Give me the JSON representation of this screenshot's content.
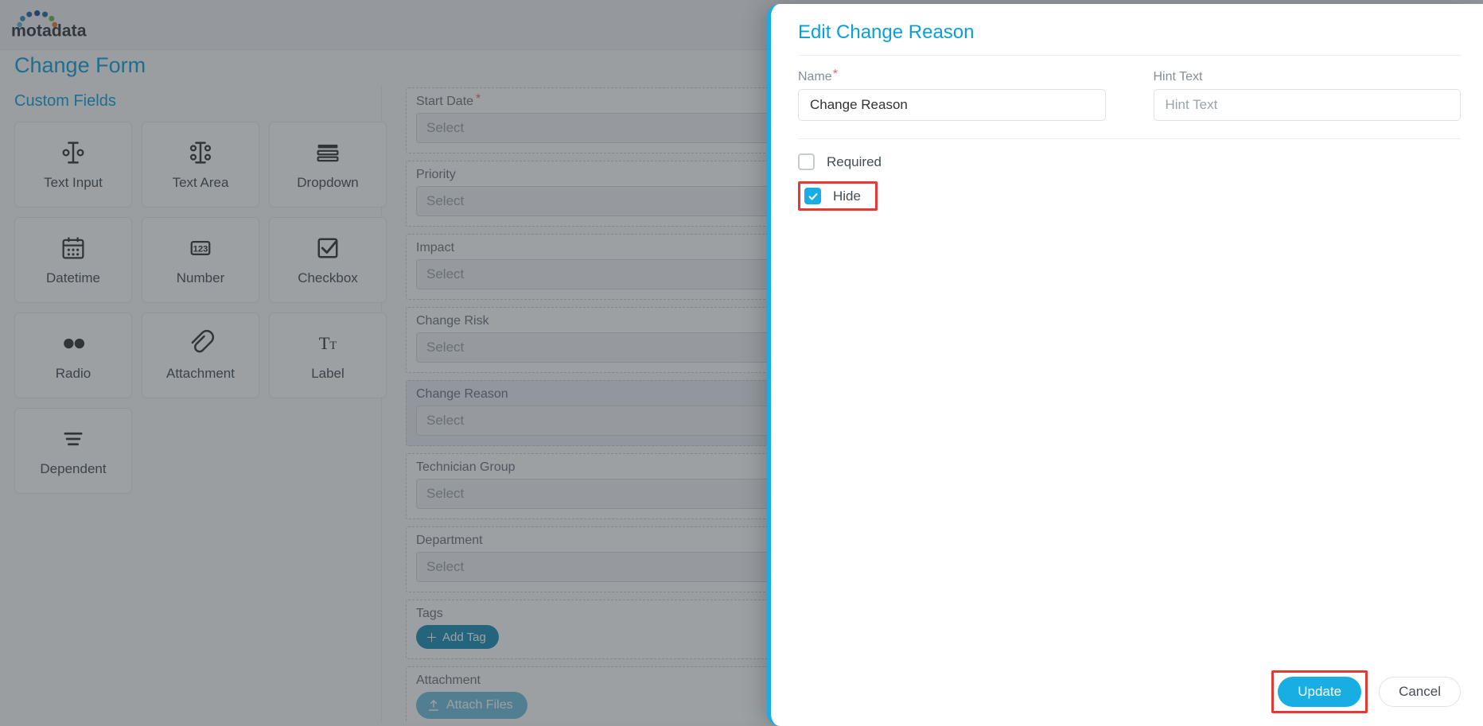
{
  "logo_text": "motadata",
  "page_title": "Change Form",
  "custom_fields_title": "Custom Fields",
  "field_types": [
    {
      "icon": "text-input",
      "label": "Text Input"
    },
    {
      "icon": "text-area",
      "label": "Text Area"
    },
    {
      "icon": "dropdown",
      "label": "Dropdown"
    },
    {
      "icon": "datetime",
      "label": "Datetime"
    },
    {
      "icon": "number",
      "label": "Number"
    },
    {
      "icon": "checkbox",
      "label": "Checkbox"
    },
    {
      "icon": "radio",
      "label": "Radio"
    },
    {
      "icon": "attachment",
      "label": "Attachment"
    },
    {
      "icon": "label",
      "label": "Label"
    },
    {
      "icon": "dependent",
      "label": "Dependent"
    }
  ],
  "form_rows": [
    {
      "label": "Start Date",
      "required": true,
      "placeholder": "Select",
      "highlighted": false
    },
    {
      "label": "Priority",
      "required": false,
      "placeholder": "Select",
      "highlighted": false
    },
    {
      "label": "Impact",
      "required": false,
      "placeholder": "Select",
      "highlighted": false
    },
    {
      "label": "Change Risk",
      "required": false,
      "placeholder": "Select",
      "highlighted": false
    },
    {
      "label": "Change Reason",
      "required": false,
      "placeholder": "Select",
      "highlighted": true
    },
    {
      "label": "Technician Group",
      "required": false,
      "placeholder": "Select",
      "highlighted": false
    },
    {
      "label": "Department",
      "required": false,
      "placeholder": "Select",
      "highlighted": false
    }
  ],
  "tags_label": "Tags",
  "add_tag": "Add Tag",
  "attachment_label": "Attachment",
  "attach_files": "Attach Files",
  "panel": {
    "title": "Edit Change Reason",
    "name_label": "Name",
    "name_value": "Change Reason",
    "hint_label": "Hint Text",
    "hint_placeholder": "Hint Text",
    "required_label": "Required",
    "hide_label": "Hide",
    "update": "Update",
    "cancel": "Cancel"
  }
}
